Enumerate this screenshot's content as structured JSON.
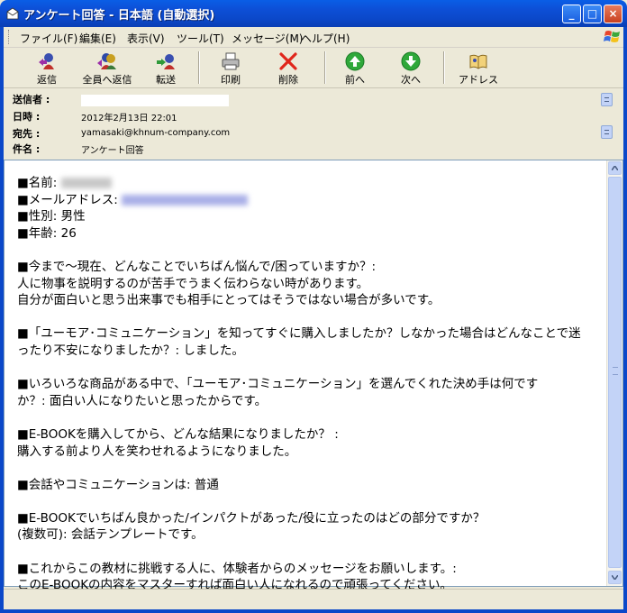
{
  "window": {
    "title": "アンケート回答 - 日本語 (自動選択)",
    "buttons": {
      "minimize": "_",
      "maximize": "□",
      "close": "×"
    }
  },
  "menu": [
    "ファイル(F)",
    "編集(E)",
    "表示(V)",
    "ツール(T)",
    "メッセージ(M)",
    "ヘルプ(H)"
  ],
  "toolbar": {
    "reply": "返信",
    "reply_all": "全員へ返信",
    "forward": "転送",
    "print": "印刷",
    "delete": "削除",
    "previous": "前へ",
    "next": "次へ",
    "addresses": "アドレス"
  },
  "header": {
    "from_label": "送信者 :",
    "date_label": "日時 :",
    "date_value": "2012年2月13日 22:01",
    "to_label": "宛先 :",
    "to_value": "yamasaki@khnum-company.com",
    "subject_label": "件名 :",
    "subject_value": "アンケート回答"
  },
  "body": {
    "name_label": "■名前:",
    "email_label": "■メールアドレス:",
    "gender_label": "■性別:",
    "gender_value": "男性",
    "age_label": "■年齢:",
    "age_value": "26",
    "q1_line": "■今まで〜現在、どんなことでいちばん悩んで/困っていますか？:",
    "a1_line1": "人に物事を説明するのが苦手でうまく伝わらない時があります。",
    "a1_line2": "自分が面白いと思う出来事でも相手にとってはそうではない場合が多いです。",
    "q2_line1": "■「ユーモア･コミュニケーション」を知ってすぐに購入しましたか？しなかった場合はどんなことで迷",
    "q2_line2": "ったり不安になりましたか？: しました。",
    "q3_line1": "■いろいろな商品がある中で、「ユーモア･コミュニケーション」を選んでくれた決め手は何です",
    "q3_line2": "か？: 面白い人になりたいと思ったからです。",
    "q4_line": "■E-BOOKを購入してから、どんな結果になりましたか？ :",
    "a4_line": "購入する前より人を笑わせれるようになりました。",
    "q5_line": "■会話やコミュニケーションは: 普通",
    "q6_line1": "■E-BOOKでいちばん良かった/インパクトがあった/役に立ったのはどの部分ですか？",
    "q6_line2": "(複数可): 会話テンプレートです。",
    "q7_line1": "■これからこの教材に挑戦する人に、体験者からのメッセージをお願いします。:",
    "q7_line2": "このE-BOOKの内容をマスターすれば面白い人になれるので頑張ってください。"
  }
}
